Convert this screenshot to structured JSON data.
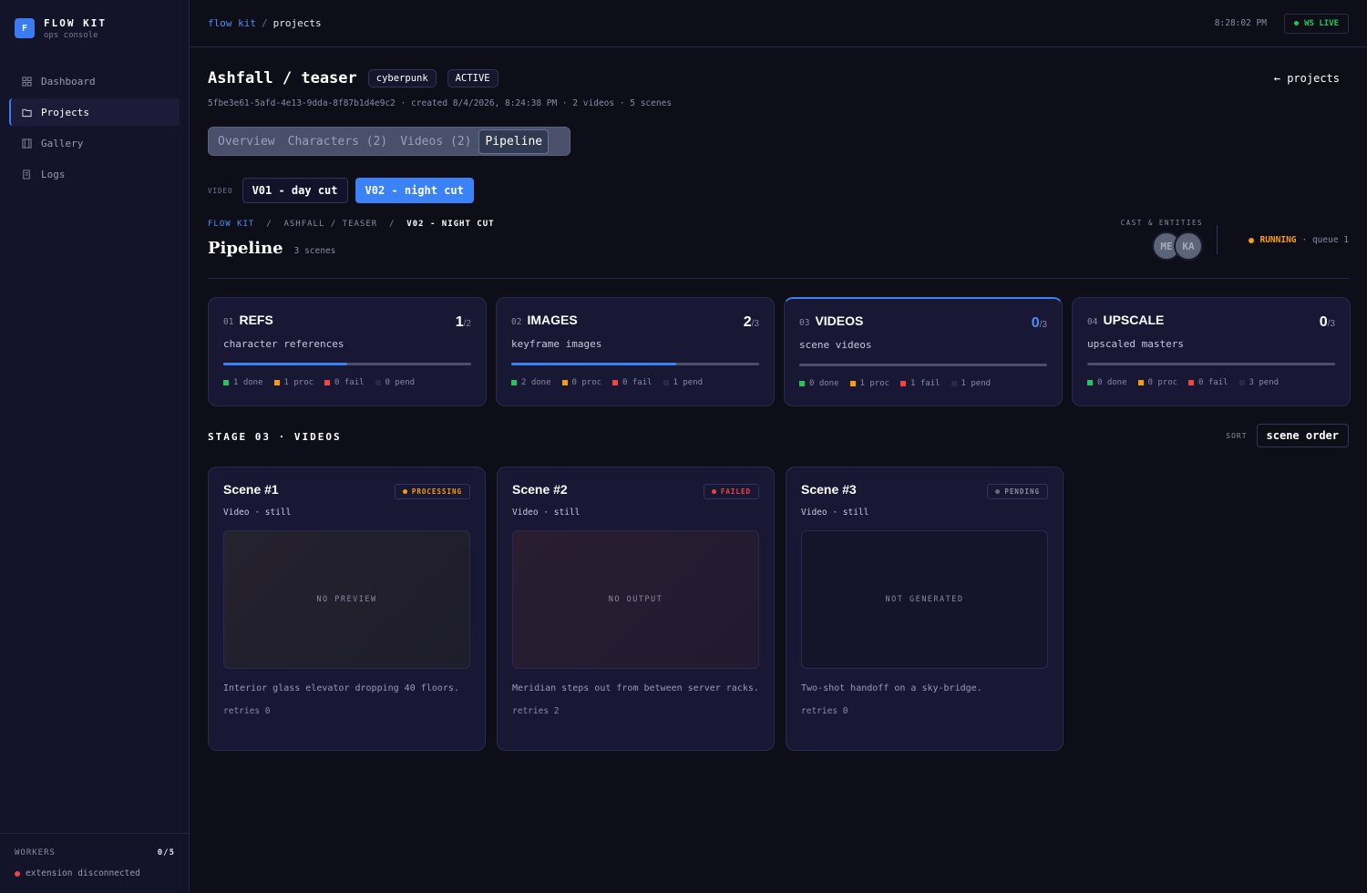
{
  "app": {
    "name": "FLOW KIT",
    "subtitle": "ops console",
    "logo_letter": "F"
  },
  "sidebar": {
    "items": [
      {
        "label": "Dashboard",
        "icon": "grid-icon",
        "active": false
      },
      {
        "label": "Projects",
        "icon": "folder-icon",
        "active": true
      },
      {
        "label": "Gallery",
        "icon": "film-icon",
        "active": false
      },
      {
        "label": "Logs",
        "icon": "scroll-icon",
        "active": false
      }
    ],
    "workers_label": "WORKERS",
    "workers_count": "0/5",
    "extension_status": "extension disconnected"
  },
  "topbar": {
    "crumb_root": "flow kit",
    "crumb_current": "projects",
    "clock": "8:28:02 PM",
    "live_label": "WS LIVE"
  },
  "project": {
    "title": "Ashfall / teaser",
    "tag": "cyberpunk",
    "status": "ACTIVE",
    "back_label": "← projects",
    "meta": "5fbe3e61-5afd-4e13-9dda-8f87b1d4e9c2 · created 8/4/2026, 8:24:38 PM · 2 videos · 5 scenes"
  },
  "tabs": [
    {
      "label": "Overview",
      "active": false
    },
    {
      "label": "Characters (2)",
      "active": false
    },
    {
      "label": "Videos (2)",
      "active": false
    },
    {
      "label": "Pipeline",
      "active": true
    }
  ],
  "video_select": {
    "label": "VIDEO",
    "options": [
      {
        "label": "V01 - day cut",
        "selected": false
      },
      {
        "label": "V02 - night cut",
        "selected": true
      }
    ]
  },
  "pipeline": {
    "crumb": [
      "FLOW KIT",
      "ASHFALL / TEASER",
      "V02 - NIGHT CUT"
    ],
    "title": "Pipeline",
    "scene_count": "3 scenes",
    "cast_label": "CAST & ENTITIES",
    "cast": [
      "ME",
      "KA"
    ],
    "status": "RUNNING",
    "queue": "· queue 1"
  },
  "stages": [
    {
      "num": "01",
      "name": "REFS",
      "done_count": "1",
      "total": "/2",
      "desc": "character references",
      "progress": 0.5,
      "active": false,
      "legend": [
        "1 done",
        "1 proc",
        "0 fail",
        "0 pend"
      ]
    },
    {
      "num": "02",
      "name": "IMAGES",
      "done_count": "2",
      "total": "/3",
      "desc": "keyframe images",
      "progress": 0.667,
      "active": false,
      "legend": [
        "2 done",
        "0 proc",
        "0 fail",
        "1 pend"
      ]
    },
    {
      "num": "03",
      "name": "VIDEOS",
      "done_count": "0",
      "total": "/3",
      "desc": "scene videos",
      "progress": 0,
      "active": true,
      "legend": [
        "0 done",
        "1 proc",
        "1 fail",
        "1 pend"
      ]
    },
    {
      "num": "04",
      "name": "UPSCALE",
      "done_count": "0",
      "total": "/3",
      "desc": "upscaled masters",
      "progress": 0,
      "active": false,
      "legend": [
        "0 done",
        "0 proc",
        "0 fail",
        "3 pend"
      ]
    }
  ],
  "stage_section": {
    "label": "STAGE 03 · VIDEOS",
    "sort_label": "SORT",
    "sort_value": "scene order"
  },
  "scenes": [
    {
      "title": "Scene #1",
      "status": "PROCESSING",
      "status_kind": "proc",
      "sub": "Video · still",
      "preview": "NO PREVIEW",
      "desc": "Interior glass elevator dropping 40 floors.",
      "retries": "retries 0"
    },
    {
      "title": "Scene #2",
      "status": "FAILED",
      "status_kind": "fail",
      "sub": "Video · still",
      "preview": "NO OUTPUT",
      "desc": "Meridian steps out from between server racks.",
      "retries": "retries 2"
    },
    {
      "title": "Scene #3",
      "status": "PENDING",
      "status_kind": "pend",
      "sub": "Video · still",
      "preview": "NOT GENERATED",
      "desc": "Two-shot handoff on a sky-bridge.",
      "retries": "retries 0"
    }
  ],
  "colors": {
    "accent": "#3b82f6",
    "done": "#22c55e",
    "proc": "#f59e0b",
    "fail": "#ef4444",
    "pend": "#2a2a44"
  }
}
